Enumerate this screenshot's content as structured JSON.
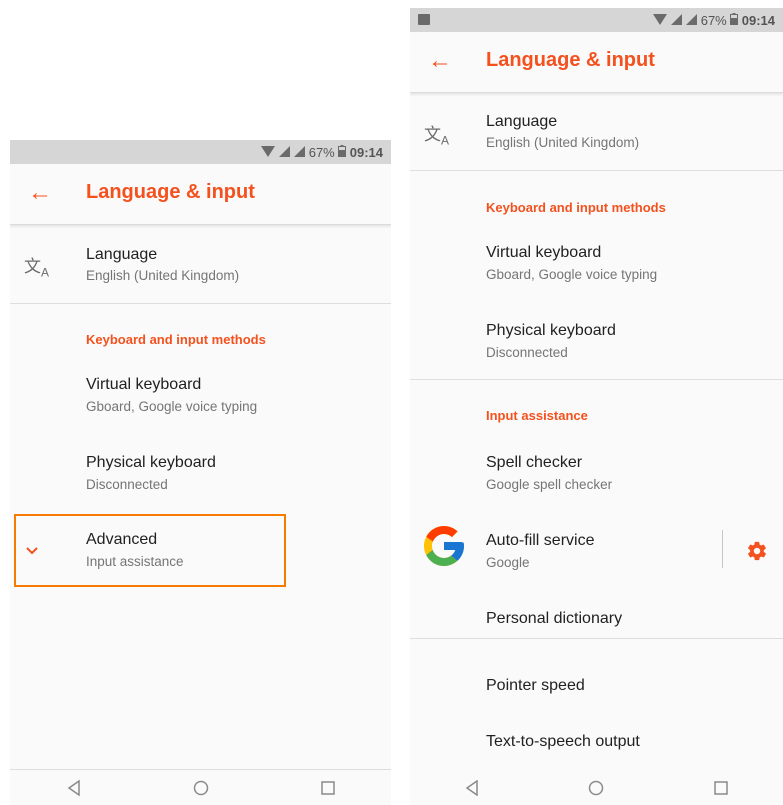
{
  "status": {
    "battery": "67%",
    "time": "09:14"
  },
  "toolbar": {
    "title": "Language & input"
  },
  "language": {
    "title": "Language",
    "subtitle": "English (United Kingdom)"
  },
  "sections": {
    "keyboard": "Keyboard and input methods",
    "assistance": "Input assistance"
  },
  "virtual_keyboard": {
    "title": "Virtual keyboard",
    "subtitle": "Gboard, Google voice typing"
  },
  "physical_keyboard": {
    "title": "Physical keyboard",
    "subtitle": "Disconnected"
  },
  "advanced": {
    "title": "Advanced",
    "subtitle": "Input assistance"
  },
  "spell_checker": {
    "title": "Spell checker",
    "subtitle": "Google spell checker"
  },
  "autofill": {
    "title": "Auto-fill service",
    "subtitle": "Google"
  },
  "personal_dictionary": {
    "title": "Personal dictionary"
  },
  "pointer_speed": {
    "title": "Pointer speed"
  },
  "tts": {
    "title": "Text-to-speech output"
  },
  "icons": {
    "translate": "translate-icon",
    "back": "back-arrow-icon",
    "expand": "chevron-down-icon",
    "google": "google-logo-icon",
    "settings": "gear-icon",
    "nav_back": "nav-back-icon",
    "nav_home": "nav-home-icon",
    "nav_recents": "nav-recents-icon"
  },
  "colors": {
    "accent": "#f4511e",
    "highlight": "#f57c00",
    "statusbar": "#d6d6d6"
  }
}
